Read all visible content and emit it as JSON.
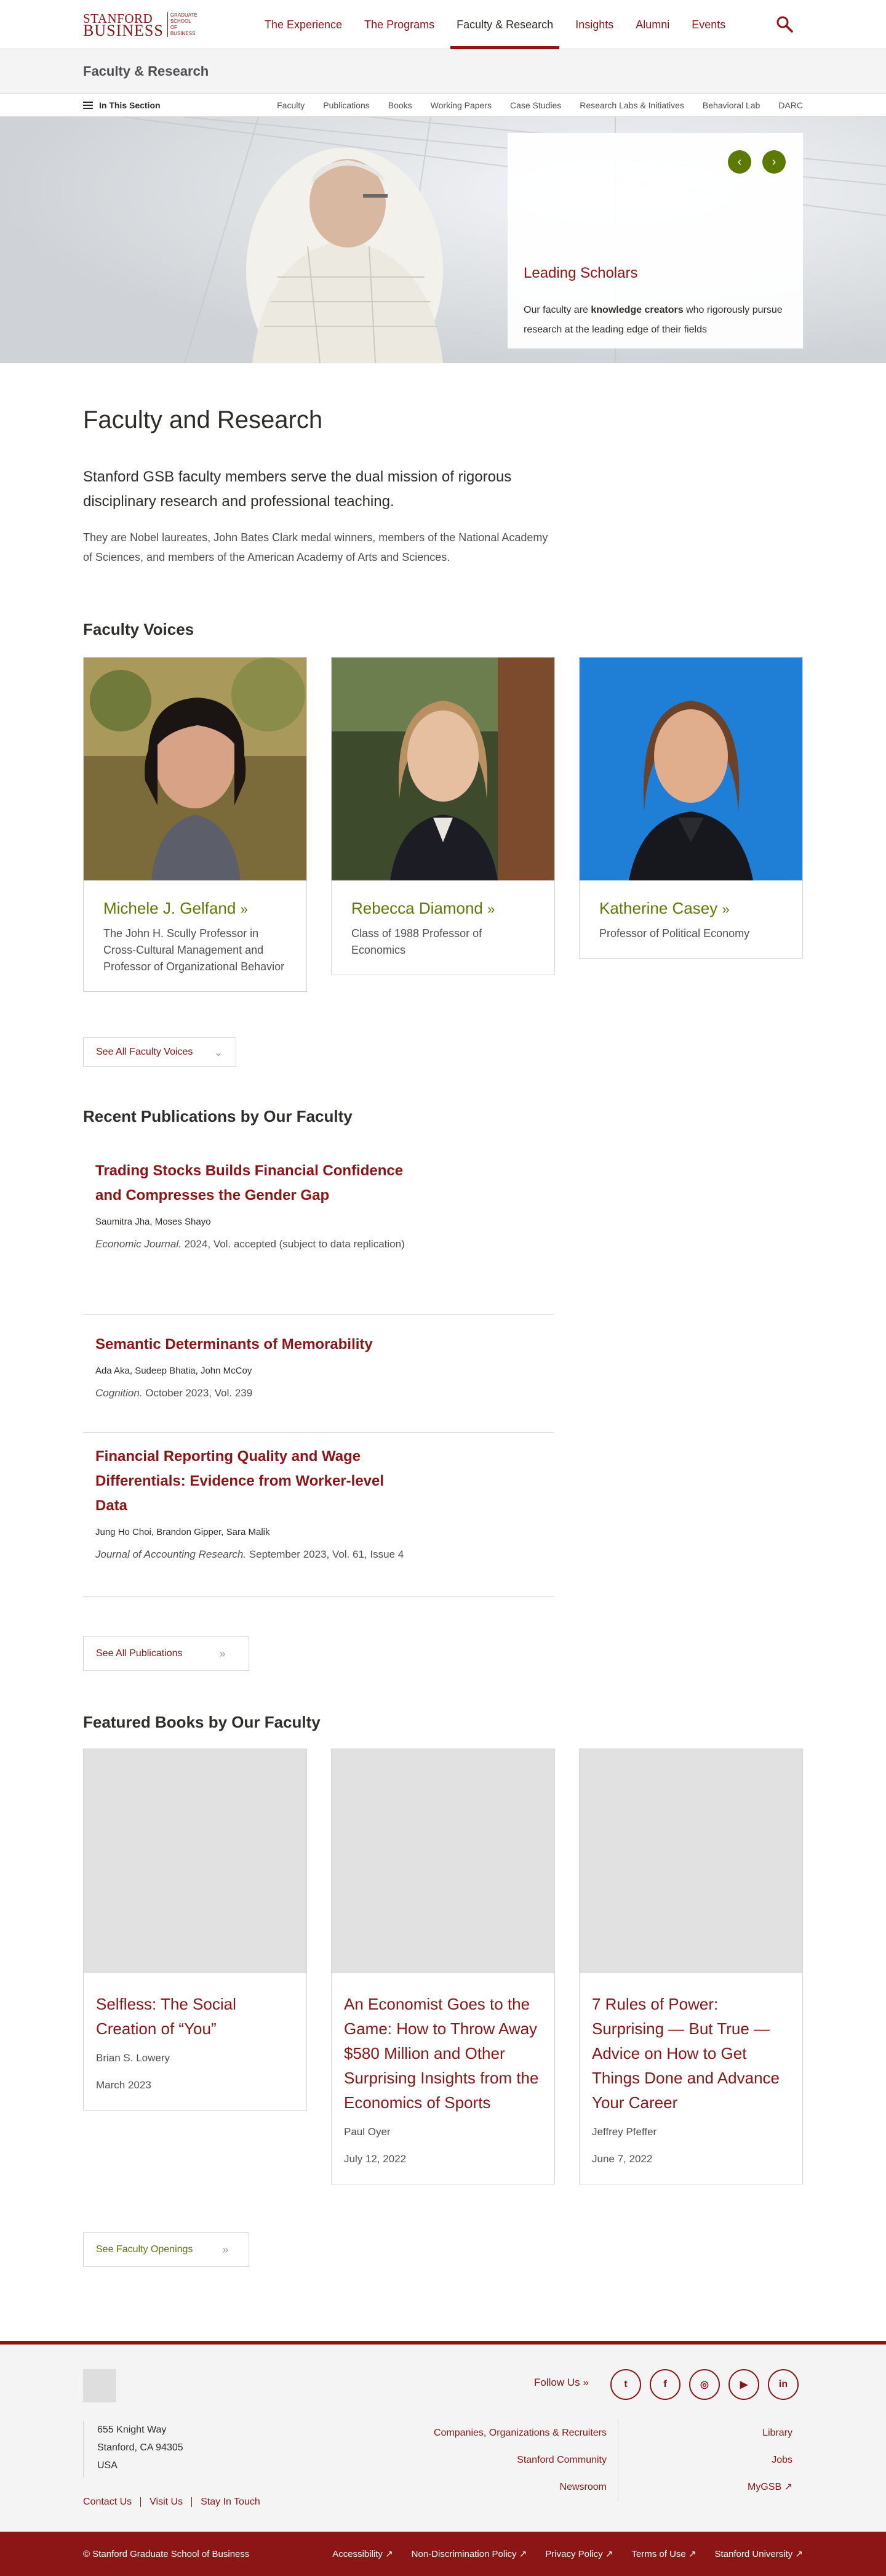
{
  "header": {
    "logo_top": "STANFORD",
    "logo_bottom": "BUSINESS",
    "logo_side": "GRADUATE SCHOOL OF BUSINESS",
    "nav": [
      "The Experience",
      "The Programs",
      "Faculty & Research",
      "Insights",
      "Alumni",
      "Events"
    ],
    "active_nav": "Faculty & Research",
    "search_icon": "search-icon"
  },
  "section_header": {
    "title": "Faculty & Research"
  },
  "subnav": {
    "in_section": "In This Section",
    "links": [
      "Faculty",
      "Publications",
      "Books",
      "Working Papers",
      "Case Studies",
      "Research Labs & Initiatives",
      "Behavioral Lab",
      "DARC"
    ]
  },
  "hero": {
    "title": "Leading Scholars",
    "text_before": "Our faculty are ",
    "text_bold": "knowledge creators",
    "text_after": " who rigorously pursue research at the leading edge of their fields",
    "prev_icon": "chevron-left-icon",
    "next_icon": "chevron-right-icon"
  },
  "intro": {
    "title": "Faculty and Research",
    "lead": "Stanford GSB faculty members serve the dual mission of rigorous disciplinary research and professional teaching.",
    "body": "They are Nobel laureates, John Bates Clark medal winners, members of the National Academy of Sciences, and members of the American Academy of Arts and Sciences."
  },
  "faculty_voices": {
    "title": "Faculty Voices",
    "people": [
      {
        "name": "Michele J. Gelfand",
        "desc": "The John H. Scully Professor in Cross-Cultural Management and Professor of Organizational Behavior"
      },
      {
        "name": "Rebecca Diamond",
        "desc": "Class of 1988 Professor of Economics"
      },
      {
        "name": "Katherine Casey",
        "desc": "Professor of Political Economy"
      }
    ],
    "see_all": "See All Faculty Voices"
  },
  "publications": {
    "title": "Recent Publications by Our Faculty",
    "items": [
      {
        "title": "Trading Stocks Builds Financial Confidence and Compresses the Gender Gap",
        "authors": "Saumitra Jha, Moses Shayo",
        "journal": "Economic Journal.",
        "details": " 2024, Vol. accepted (subject to data replication)"
      },
      {
        "title": "Semantic Determinants of Memorability",
        "authors": "Ada Aka, Sudeep Bhatia, John McCoy",
        "journal": "Cognition.",
        "details": " October 2023, Vol. 239"
      },
      {
        "title": "Financial Reporting Quality and Wage Differentials: Evidence from Worker-level Data",
        "authors": "Jung Ho Choi, Brandon Gipper, Sara Malik",
        "journal": "Journal of Accounting Research.",
        "details": " September 2023, Vol. 61, Issue 4"
      }
    ],
    "see_all": "See All Publications"
  },
  "books": {
    "title": "Featured Books by Our Faculty",
    "items": [
      {
        "title": "Selfless: The Social Creation of “You”",
        "author": "Brian S. Lowery",
        "date": "March 2023"
      },
      {
        "title": "An Economist Goes to the Game: How to Throw Away $580 Million and Other Surprising Insights from the Economics of Sports",
        "author": "Paul Oyer",
        "date": "July 12, 2022"
      },
      {
        "title": "7 Rules of Power: Surprising — But True — Advice on How to Get Things Done and Advance Your Career",
        "author": "Jeffrey Pfeffer",
        "date": "June 7, 2022"
      }
    ],
    "openings": "See Faculty Openings"
  },
  "footer": {
    "follow": "Follow Us",
    "socials": [
      "twitter-icon",
      "facebook-icon",
      "instagram-icon",
      "youtube-icon",
      "linkedin-icon"
    ],
    "address": [
      "655 Knight Way",
      "Stanford, CA 94305",
      "USA"
    ],
    "mid_links": [
      "Companies, Organizations & Recruiters",
      "Stanford Community",
      "Newsroom"
    ],
    "right_links": [
      "Library",
      "Jobs",
      "MyGSB"
    ],
    "bottom_links": [
      "Contact Us",
      "Visit Us",
      "Stay In Touch"
    ],
    "copyright": "© Stanford Graduate School of Business",
    "legal": [
      "Accessibility",
      "Non-Discrimination Policy",
      "Privacy Policy",
      "Terms of Use",
      "Stanford University"
    ]
  },
  "colors": {
    "brand": "#8c1515",
    "accent_green": "#5d7a00",
    "border": "#d5d5d4"
  }
}
